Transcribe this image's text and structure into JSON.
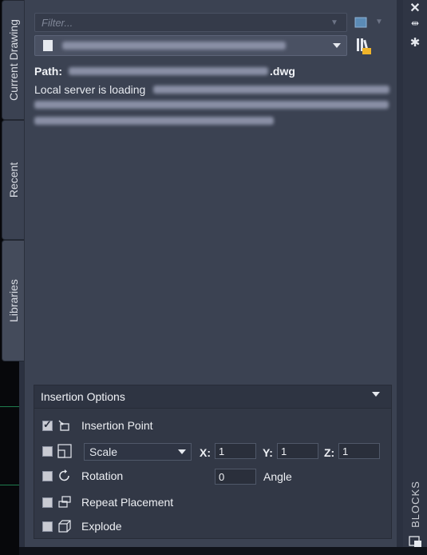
{
  "tabs": {
    "current_drawing": "Current Drawing",
    "recent": "Recent",
    "libraries": "Libraries"
  },
  "filter": {
    "placeholder": "Filter..."
  },
  "path": {
    "label": "Path:",
    "suffix": ".dwg"
  },
  "loading": {
    "prefix": "Local server is loading"
  },
  "insertion_options": {
    "title": "Insertion Options",
    "insertion_point": {
      "label": "Insertion Point",
      "checked": true
    },
    "scale": {
      "mode": "Scale",
      "x_label": "X:",
      "x": "1",
      "y_label": "Y:",
      "y": "1",
      "z_label": "Z:",
      "z": "1",
      "checked": false
    },
    "rotation": {
      "label": "Rotation",
      "angle": "0",
      "angle_label": "Angle",
      "checked": false
    },
    "repeat_placement": {
      "label": "Repeat Placement",
      "checked": false
    },
    "explode": {
      "label": "Explode",
      "checked": false
    }
  },
  "side_panel": {
    "label": "BLOCKS"
  },
  "colors": {
    "panel": "#3b4252",
    "accent_green": "#1e7d4e",
    "checkbox": "#c9cbd3"
  },
  "icons": [
    "close-icon",
    "auto-hide-icon",
    "settings-icon",
    "thumbnail-view-icon",
    "browse-library-icon",
    "insertion-point-icon",
    "scale-icon",
    "rotation-icon",
    "repeat-placement-icon",
    "explode-icon",
    "blocks-palette-icon"
  ]
}
